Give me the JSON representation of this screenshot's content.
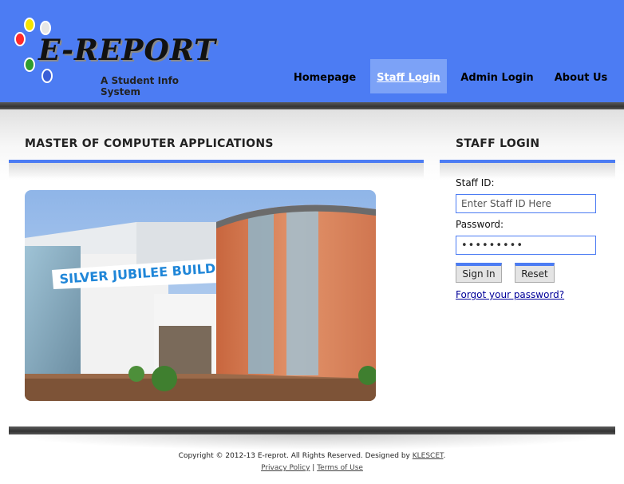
{
  "brand": {
    "title": "E-REPORT",
    "subtitle": "A Student Info System",
    "dot_colors": [
      "#ff2a2a",
      "#f5e400",
      "#2f9d2f",
      "#3b5fd6",
      "#e6e6e6",
      "#ffffff"
    ]
  },
  "nav": {
    "items": [
      {
        "label": "Homepage",
        "active": false
      },
      {
        "label": "Staff Login",
        "active": true
      },
      {
        "label": "Admin Login",
        "active": false
      },
      {
        "label": "About Us",
        "active": false
      }
    ]
  },
  "main": {
    "title": "MASTER OF COMPUTER APPLICATIONS",
    "photo_sign": "SILVER JUBILEE BUILDING"
  },
  "login": {
    "title": "STAFF LOGIN",
    "staff_id_label": "Staff ID:",
    "staff_id_placeholder": "Enter Staff ID Here",
    "staff_id_value": "",
    "password_label": "Password:",
    "password_value": "•••••••••",
    "sign_in_label": "Sign In",
    "reset_label": "Reset",
    "forgot_label": "Forgot your password?"
  },
  "footer": {
    "copyright_prefix": "Copyright © 2012-13 E-reprot. All Rights Reserved. Designed by ",
    "designer": "KLESCET",
    "copyright_suffix": ".",
    "privacy_label": "Privacy Policy",
    "separator": "|",
    "terms_label": "Terms of Use"
  },
  "colors": {
    "header_blue": "#4c7cf3",
    "active_tab": "#7ca2f7",
    "link_blue": "#000099"
  }
}
